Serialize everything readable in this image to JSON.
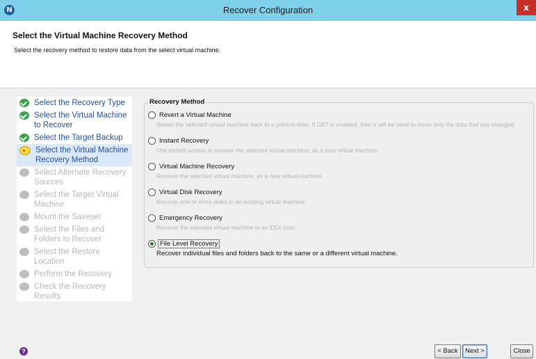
{
  "window": {
    "title": "Recover Configuration",
    "app_icon": "N",
    "close_label": "x"
  },
  "header": {
    "title": "Select the Virtual Machine Recovery Method",
    "description": "Select the recovery method to restore data from the select virtual machine."
  },
  "steps": [
    {
      "label": "Select the Recovery Type",
      "state": "done"
    },
    {
      "label": "Select the Virtual Machine to Recover",
      "state": "done"
    },
    {
      "label": "Select the Target Backup",
      "state": "done"
    },
    {
      "label": "Select the Virtual Machine Recovery Method",
      "state": "current"
    },
    {
      "label": "Select Alternate Recovery Sources",
      "state": "pending"
    },
    {
      "label": "Select the Target Virtual Machine",
      "state": "pending"
    },
    {
      "label": "Mount the Saveset",
      "state": "pending"
    },
    {
      "label": "Select the Files and Folders to Recover",
      "state": "pending"
    },
    {
      "label": "Select the Restore Location",
      "state": "pending"
    },
    {
      "label": "Perform the Recovery",
      "state": "pending"
    },
    {
      "label": "Check the Recovery Results",
      "state": "pending"
    }
  ],
  "recovery_method": {
    "legend": "Recovery Method",
    "options": [
      {
        "label": "Revert a Virtual Machine",
        "description": "Revert the selected virtual machine back to a point-in-time. If CBT is enabled, then it will be used to move only the data that has changed",
        "selected": false
      },
      {
        "label": "Instant Recovery",
        "description": "Use instant access to recover the selected virtual machine, as a new virtual machine.",
        "selected": false
      },
      {
        "label": "Virtual Machine Recovery",
        "description": "Recover the selected virtual machine, as a new virtual machine.",
        "selected": false
      },
      {
        "label": "Virtual Disk Recovery",
        "description": "Recover one or more disks to an existing virtual machine.",
        "selected": false
      },
      {
        "label": "Emergency Recovery",
        "description": "Recover the selected virtual machine to an ESX host.",
        "selected": false
      },
      {
        "label": "File Level Recovery",
        "description": "Recover individual files and folders back to the same or a different virtual machine.",
        "selected": true
      }
    ]
  },
  "footer": {
    "help_label": "?",
    "back_label": "< Back",
    "next_label": "Next >",
    "close_label": "Close"
  }
}
